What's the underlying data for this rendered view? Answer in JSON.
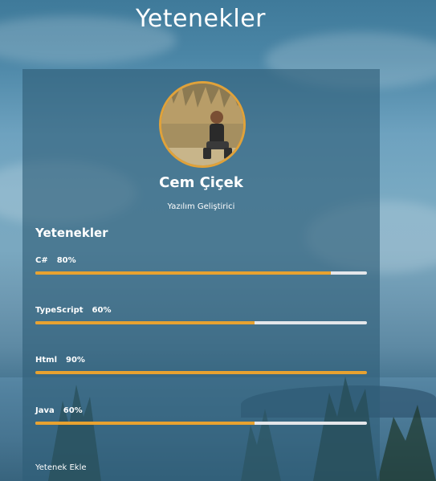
{
  "page": {
    "title": "Yetenekler"
  },
  "profile": {
    "name": "Cem Çiçek",
    "role": "Yazılım Geliştirici",
    "avatar_border_color": "#e0a23a"
  },
  "skills": {
    "heading": "Yetenekler",
    "items": [
      {
        "name": "C#",
        "percent_label": "80%",
        "level": 0.89
      },
      {
        "name": "TypeScript",
        "percent_label": "60%",
        "level": 0.66
      },
      {
        "name": "Html",
        "percent_label": "90%",
        "level": 1.0
      },
      {
        "name": "Java",
        "percent_label": "60%",
        "level": 0.66
      }
    ],
    "bar_fill_color": "#e8a230",
    "bar_track_color": "#e4e6ea"
  },
  "actions": {
    "add_skill_label": "Yetenek Ekle"
  }
}
